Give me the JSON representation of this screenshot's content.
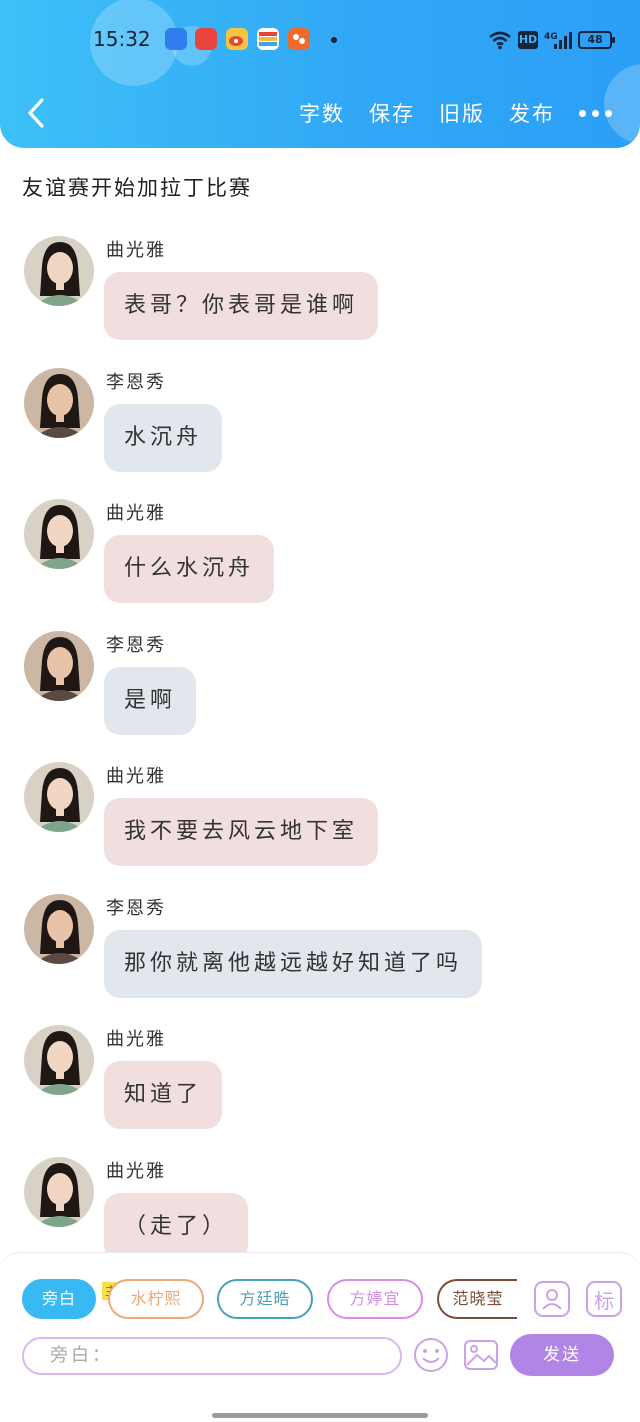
{
  "status_bar": {
    "time": "15:32",
    "icons": [
      "app-blue-icon",
      "app-red-icon",
      "weibo-icon",
      "wallet-icon",
      "app-orange-icon",
      "wifi-icon",
      "hd-icon",
      "signal-4g-icon",
      "battery-icon"
    ],
    "hd_label": "HD",
    "network_label": "4G",
    "battery": "48"
  },
  "header": {
    "toolbar": {
      "word_count": "字数",
      "save": "保存",
      "old_version": "旧版",
      "publish": "发布"
    },
    "colors": {
      "gradient_start": "#3ec0f7",
      "gradient_end": "#2c9ff6"
    }
  },
  "story": {
    "title": "友谊赛开始加拉丁比赛"
  },
  "messages": [
    {
      "speaker": "曲光雅",
      "text": "表哥？你表哥是谁啊"
    },
    {
      "speaker": "李恩秀",
      "text": "水沉舟"
    },
    {
      "speaker": "曲光雅",
      "text": "什么水沉舟"
    },
    {
      "speaker": "李恩秀",
      "text": "是啊"
    },
    {
      "speaker": "曲光雅",
      "text": "我不要去风云地下室"
    },
    {
      "speaker": "李恩秀",
      "text": "那你就离他越远越好知道了吗"
    },
    {
      "speaker": "曲光雅",
      "text": "知道了"
    },
    {
      "speaker": "曲光雅",
      "text": "（走了）"
    }
  ],
  "bubble_colors": {
    "曲光雅": "#f1dede",
    "李恩秀": "#e2e7ee"
  },
  "composer": {
    "roles": [
      {
        "label": "旁白",
        "color": "#39b9f3",
        "selected": true
      },
      {
        "label": "水柠熙",
        "color": "#f0a878",
        "badge": "主"
      },
      {
        "label": "方廷晧",
        "color": "#4aa0b8"
      },
      {
        "label": "方婷宜",
        "color": "#d88ce8"
      },
      {
        "label": "范晓莹",
        "color": "#7a4e36"
      }
    ],
    "buttons": {
      "tag": "标",
      "send": "发送"
    },
    "input_placeholder": "旁白：",
    "accent_color": "#b185e6"
  }
}
